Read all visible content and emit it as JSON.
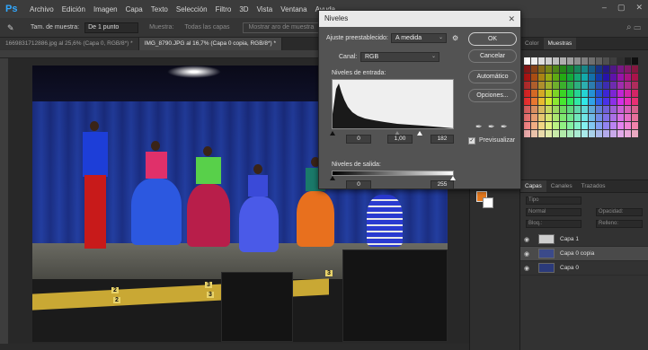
{
  "app": {
    "logo": "Ps"
  },
  "menu": [
    "Archivo",
    "Edición",
    "Imagen",
    "Capa",
    "Texto",
    "Selección",
    "Filtro",
    "3D",
    "Vista",
    "Ventana",
    "Ayuda"
  ],
  "options": {
    "sample_size_label": "Tam. de muestra:",
    "sample_size_value": "De 1 punto",
    "sample_label": "Muestra:",
    "all_layers": "Todas las capas",
    "show_ring": "Mostrar aro de muestra"
  },
  "tabs": [
    {
      "label": "1669831712886.jpg al 25,6% (Capa 0, RGB/8*) *",
      "active": false
    },
    {
      "label": "IMG_8790.JPG al 16,7% (Capa 0 copia, RGB/8*) *",
      "active": true
    }
  ],
  "photo": {
    "beam_labels": [
      "2",
      "3",
      "2",
      "3",
      "3"
    ]
  },
  "levels": {
    "title": "Niveles",
    "preset_label": "Ajuste preestablecido:",
    "preset_value": "A medida",
    "channel_label": "Canal:",
    "channel_value": "RGB",
    "input_label": "Niveles de entrada:",
    "input_black": "0",
    "input_gamma": "1,00",
    "input_white": "182",
    "output_label": "Niveles de salida:",
    "output_black": "0",
    "output_white": "255",
    "ok": "OK",
    "cancel": "Cancelar",
    "auto": "Automático",
    "options": "Opciones...",
    "preview": "Previsualizar",
    "preview_checked": true
  },
  "panels": {
    "top_tabs": [
      "Color",
      "Muestras"
    ],
    "bottom_tabs": [
      "Capas",
      "Canales",
      "Trazados"
    ],
    "search_placeholder": "Tipo",
    "blend_mode": "Normal",
    "opacity_label": "Opacidad:",
    "lock_label": "Bloq.:",
    "fill_label": "Relleno:",
    "layers": [
      {
        "name": "Capa 1",
        "selected": false,
        "thumb": "#cfcfcf"
      },
      {
        "name": "Capa 0 copia",
        "selected": true,
        "thumb": "#3b4a8a"
      },
      {
        "name": "Capa 0",
        "selected": false,
        "thumb": "#2b3a7a"
      }
    ]
  },
  "colors": {
    "foreground": "#e5791e",
    "background": "#ffffff",
    "accent": "#31a8ff"
  }
}
